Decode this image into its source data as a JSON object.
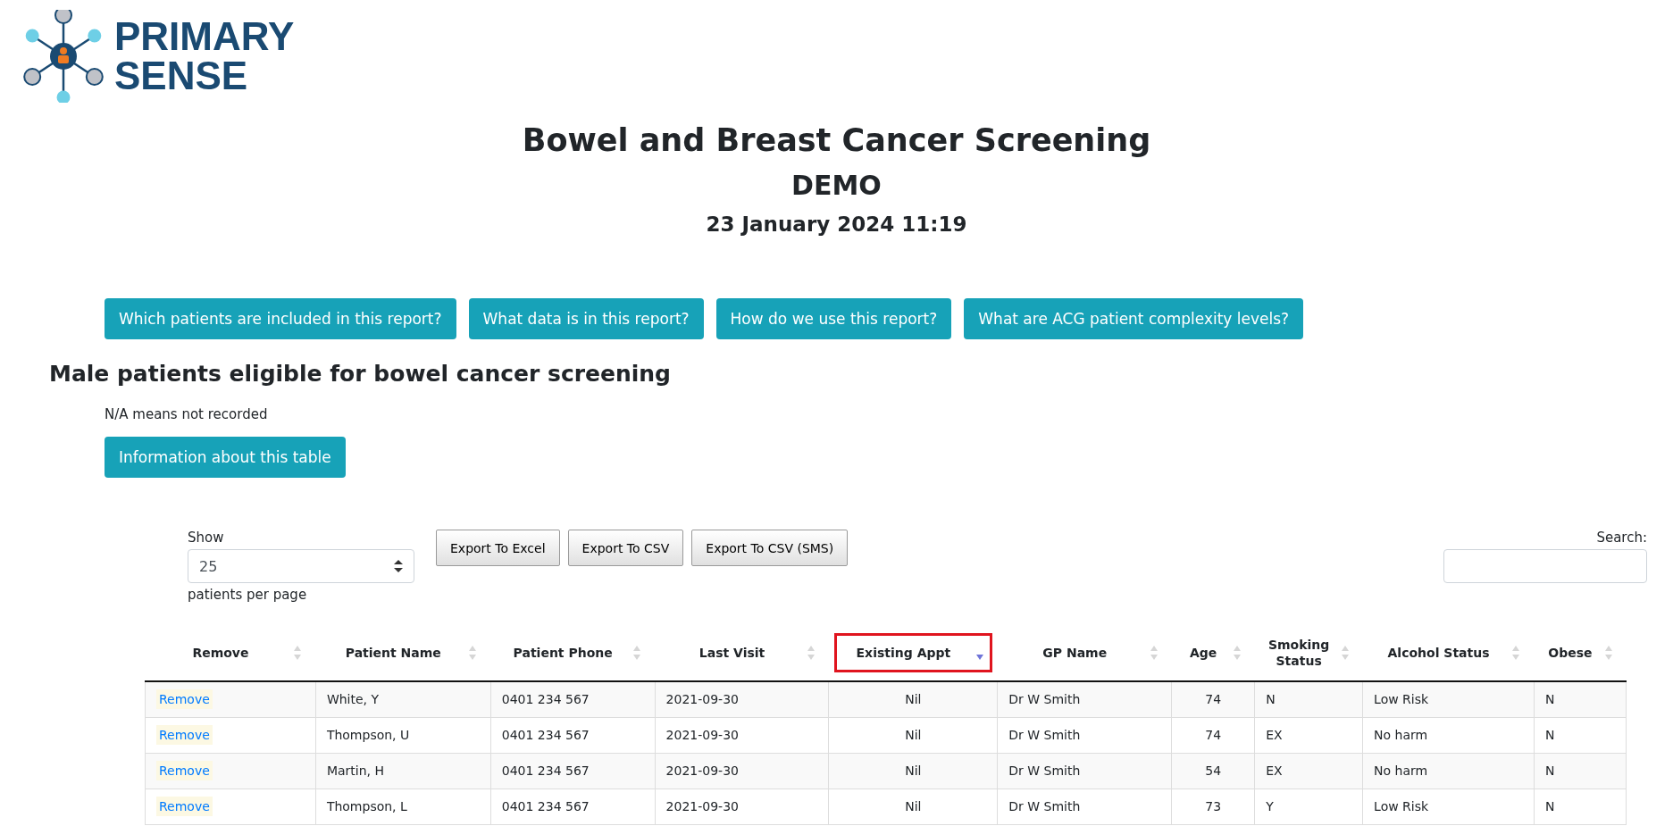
{
  "logo": {
    "line_1": "PRIMARY",
    "line_2": "SENSE"
  },
  "title": "Bowel and Breast Cancer Screening",
  "subtitle": "DEMO",
  "timestamp": "23 January 2024 11:19",
  "help_buttons": [
    "Which patients are included in this report?",
    "What data is in this report?",
    "How do we use this report?",
    "What are ACG patient complexity levels?"
  ],
  "section": {
    "heading": "Male patients eligible for bowel cancer screening",
    "note": "N/A means not recorded",
    "info_button": "Information about this table"
  },
  "table_controls": {
    "show_label": "Show",
    "page_size": "25",
    "per_page_label": "patients per page",
    "export_buttons": [
      "Export To Excel",
      "Export To CSV",
      "Export To CSV (SMS)"
    ],
    "search_label": "Search:"
  },
  "table": {
    "columns": [
      {
        "label": "Remove",
        "sorted": false,
        "highlighted": false
      },
      {
        "label": "Patient Name",
        "sorted": false,
        "highlighted": false
      },
      {
        "label": "Patient Phone",
        "sorted": false,
        "highlighted": false
      },
      {
        "label": "Last Visit",
        "sorted": false,
        "highlighted": false
      },
      {
        "label": "Existing Appt",
        "sorted": true,
        "highlighted": true
      },
      {
        "label": "GP Name",
        "sorted": false,
        "highlighted": false
      },
      {
        "label": "Age",
        "sorted": false,
        "highlighted": false
      },
      {
        "label": "Smoking Status",
        "sorted": false,
        "highlighted": false
      },
      {
        "label": "Alcohol Status",
        "sorted": false,
        "highlighted": false
      },
      {
        "label": "Obese",
        "sorted": false,
        "highlighted": false
      }
    ],
    "rows": [
      [
        "Remove",
        "White, Y",
        "0401 234 567",
        "2021-09-30",
        "Nil",
        "Dr W Smith",
        "74",
        "N",
        "Low Risk",
        "N"
      ],
      [
        "Remove",
        "Thompson, U",
        "0401 234 567",
        "2021-09-30",
        "Nil",
        "Dr W Smith",
        "74",
        "EX",
        "No harm",
        "N"
      ],
      [
        "Remove",
        "Martin, H",
        "0401 234 567",
        "2021-09-30",
        "Nil",
        "Dr W Smith",
        "54",
        "EX",
        "No harm",
        "N"
      ],
      [
        "Remove",
        "Thompson, L",
        "0401 234 567",
        "2021-09-30",
        "Nil",
        "Dr W Smith",
        "73",
        "Y",
        "Low Risk",
        "N"
      ]
    ]
  }
}
